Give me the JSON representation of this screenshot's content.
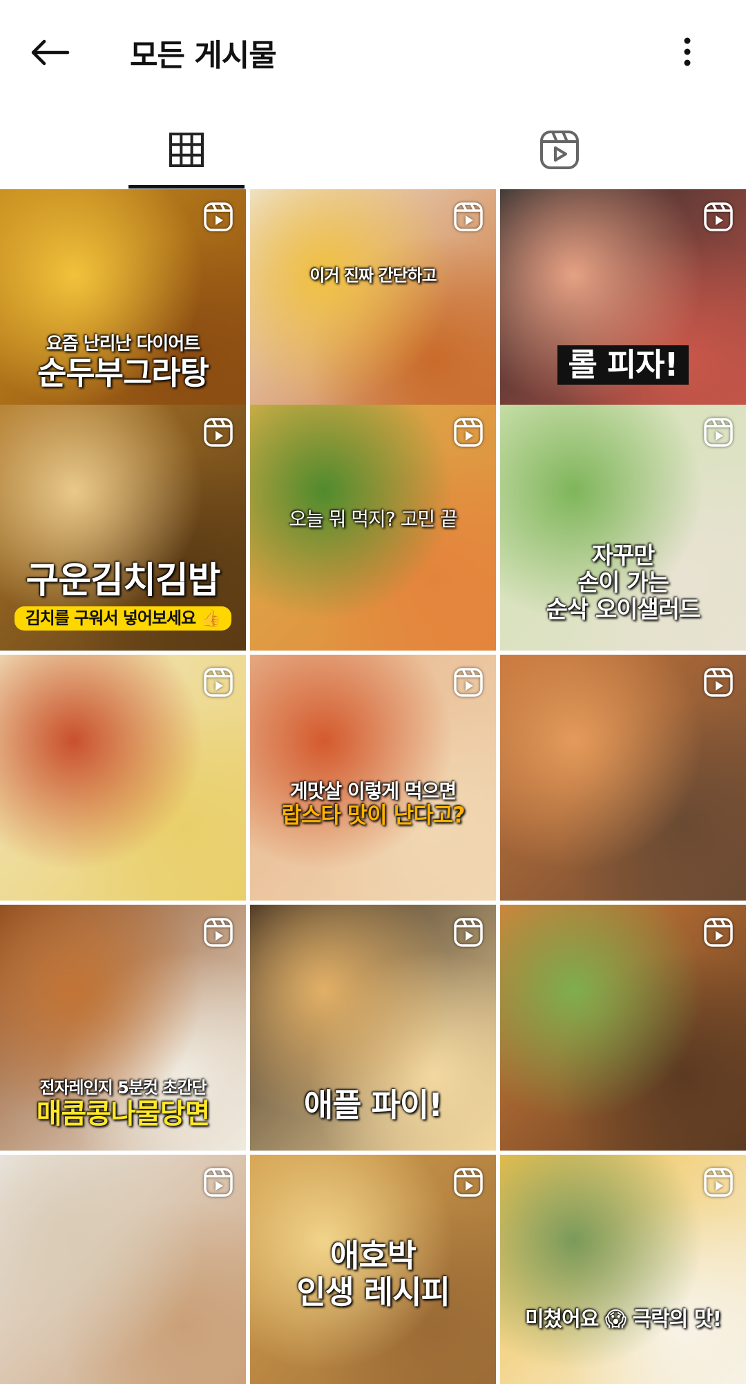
{
  "header": {
    "title": "모든 게시물",
    "back_icon": "arrow-left-icon",
    "more_icon": "more-vertical-icon"
  },
  "tabs": [
    {
      "name": "grid",
      "icon": "grid-icon",
      "selected": true
    },
    {
      "name": "reels",
      "icon": "reels-icon",
      "selected": false
    }
  ],
  "posts": [
    {
      "lines": [
        "요즘 난리난 다이어트",
        "순두부그라탕"
      ],
      "colors": [
        "#c58b1e",
        "#f2c23b",
        "#8a4b12"
      ],
      "reel": true
    },
    {
      "lines": [
        "이거 진짜 간단하고"
      ],
      "colors": [
        "#efe7d8",
        "#f0c040",
        "#c96b2a"
      ],
      "reel": true
    },
    {
      "lines": [
        "롤 피자!"
      ],
      "colors": [
        "#2b2b2b",
        "#e6a184",
        "#c9574a"
      ],
      "reel": true
    },
    {
      "lines": [
        "구운김치김밥",
        "김치를 구워서 넣어보세요 👍"
      ],
      "colors": [
        "#b07a2a",
        "#e9c98b",
        "#5a3a14"
      ],
      "reel": true
    },
    {
      "lines": [
        "오늘 뭐 먹지? 고민 끝"
      ],
      "colors": [
        "#d9b24a",
        "#4f8b2d",
        "#e4843c"
      ],
      "reel": true
    },
    {
      "lines": [
        "자꾸만",
        "손이 가는",
        "순삭 오이샐러드"
      ],
      "colors": [
        "#cfe3b0",
        "#7fb55a",
        "#e8e2d2"
      ],
      "reel": true
    },
    {
      "lines": [],
      "colors": [
        "#f3e6c0",
        "#c9502d",
        "#e9cf6a"
      ],
      "reel": true
    },
    {
      "lines": [
        "게맛살 이렇게 먹으면",
        "랍스타 맛이 난다고?"
      ],
      "colors": [
        "#e7b48c",
        "#d45a2e",
        "#f0d7b2"
      ],
      "reel": true
    },
    {
      "lines": [],
      "colors": [
        "#c8763a",
        "#e49a5a",
        "#6a4a33"
      ],
      "reel": true
    },
    {
      "lines": [
        "전자레인지 5분컷 초간단",
        "매콤콩나물당면"
      ],
      "colors": [
        "#8c4a1c",
        "#c27435",
        "#f0ebe0"
      ],
      "reel": true
    },
    {
      "lines": [
        "애플 파이!"
      ],
      "colors": [
        "#3a2a1c",
        "#e2b066",
        "#f3d8a0"
      ],
      "reel": true
    },
    {
      "lines": [],
      "colors": [
        "#d8813a",
        "#7fae4e",
        "#5b3a22"
      ],
      "reel": true
    },
    {
      "lines": [],
      "colors": [
        "#eae7e1",
        "#d9cbb5",
        "#caa078"
      ],
      "reel": true
    },
    {
      "lines": [
        "애호박",
        "인생 레시피"
      ],
      "colors": [
        "#d4a04e",
        "#f1d48a",
        "#9b6b36"
      ],
      "reel": true
    },
    {
      "lines": [
        "미쳤어요 😱 극락의 맛!"
      ],
      "colors": [
        "#f0c04a",
        "#7a9a5a",
        "#f7f3e8"
      ],
      "reel": true
    }
  ]
}
